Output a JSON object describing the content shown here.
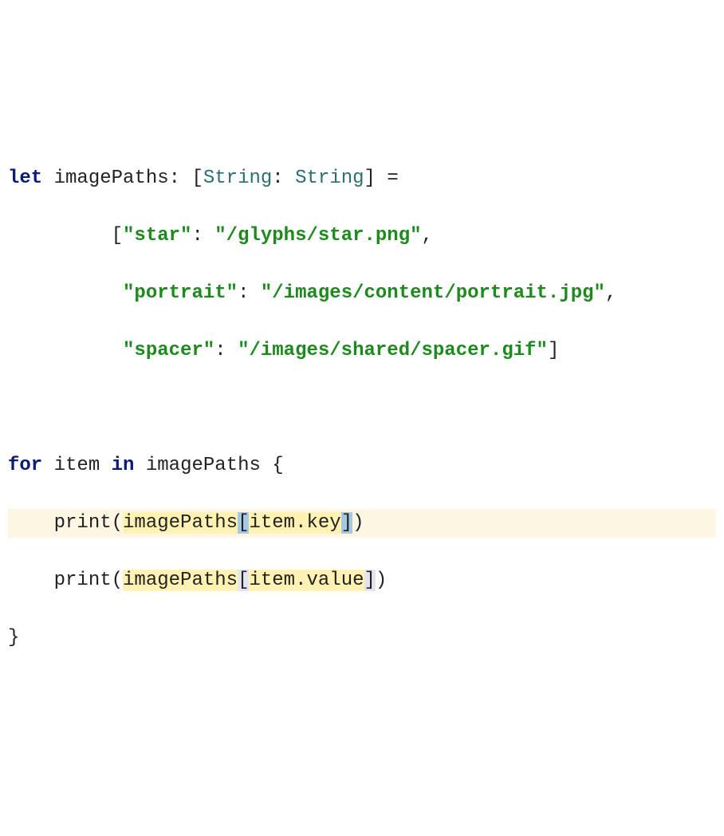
{
  "code": {
    "line1": {
      "kw_let": "let",
      "ident": "imagePaths",
      "colon": ":",
      "lbracket": "[",
      "type1": "String",
      "type_colon": ":",
      "type2": "String",
      "rbracket": "]",
      "eq": "="
    },
    "line2": {
      "lbracket": "[",
      "key1": "\"star\"",
      "colon": ":",
      "val1": "\"/glyphs/star.png\"",
      "comma": ","
    },
    "line3": {
      "key2": "\"portrait\"",
      "colon": ":",
      "val2": "\"/images/content/portrait.jpg\"",
      "comma": ","
    },
    "line4": {
      "key3": "\"spacer\"",
      "colon": ":",
      "val3": "\"/images/shared/spacer.gif\"",
      "rbracket": "]"
    },
    "line5": "",
    "line6": {
      "kw_for": "for",
      "item": "item",
      "kw_in": "in",
      "ident": "imagePaths",
      "lbrace": "{"
    },
    "line7": {
      "func": "print",
      "lparen": "(",
      "ident": "imagePaths",
      "lbracket": "[",
      "expr": "item.key",
      "rbracket": "]",
      "rparen": ")"
    },
    "line8": {
      "func": "print",
      "lparen": "(",
      "ident": "imagePaths",
      "lbracket": "[",
      "expr": "item.value",
      "rbracket": "]",
      "rparen": ")"
    },
    "line9": {
      "rbrace": "}"
    }
  }
}
